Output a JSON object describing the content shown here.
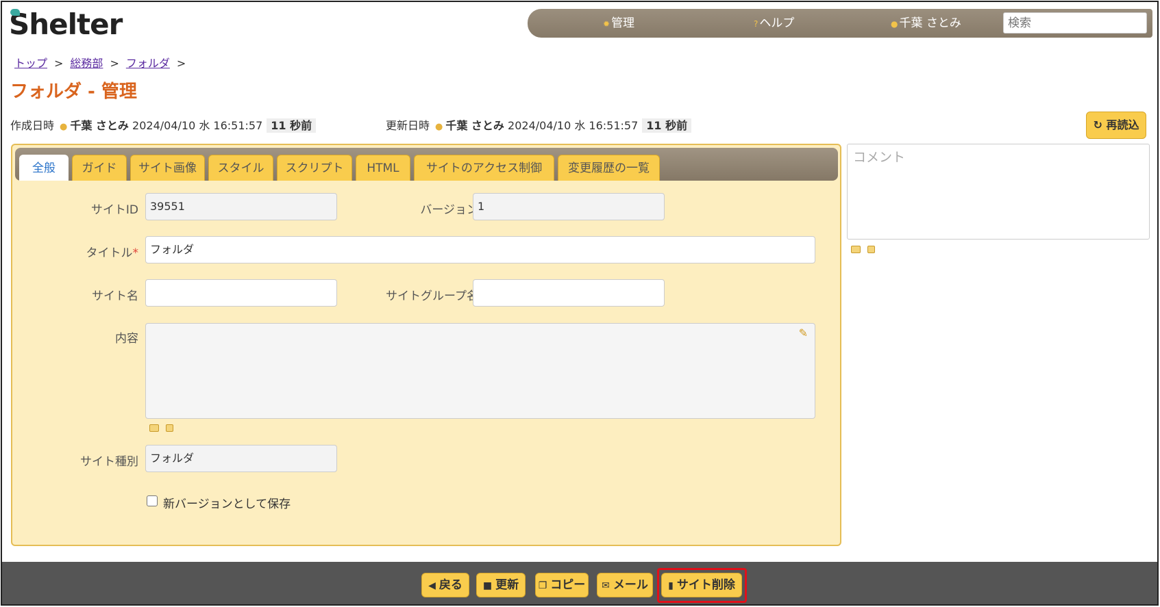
{
  "app": {
    "logo": "Shelter"
  },
  "topnav": {
    "manage": "管理",
    "help": "ヘルプ",
    "user": "千葉 さとみ",
    "search_placeholder": "検索"
  },
  "breadcrumb": [
    "トップ",
    "総務部",
    "フォルダ"
  ],
  "breadcrumb_sep": ">",
  "page_title": "フォルダ - 管理",
  "meta": {
    "created_label": "作成日時",
    "created_user": "千葉 さとみ",
    "created_time": "2024/04/10 水 16:51:57",
    "created_ago": "11 秒前",
    "updated_label": "更新日時",
    "updated_user": "千葉 さとみ",
    "updated_time": "2024/04/10 水 16:51:57",
    "updated_ago": "11 秒前"
  },
  "reload_label": "再読込",
  "tabs": [
    "全般",
    "ガイド",
    "サイト画像",
    "スタイル",
    "スクリプト",
    "HTML",
    "サイトのアクセス制御",
    "変更履歴の一覧"
  ],
  "form": {
    "site_id_label": "サイトID",
    "site_id_value": "39551",
    "version_label": "バージョン",
    "version_value": "1",
    "title_label": "タイトル",
    "title_required": "*",
    "title_value": "フォルダ",
    "site_name_label": "サイト名",
    "site_name_value": "",
    "site_group_label": "サイトグループ名",
    "site_group_value": "",
    "content_label": "内容",
    "site_type_label": "サイト種別",
    "site_type_value": "フォルダ",
    "save_new_version_label": "新バージョンとして保存"
  },
  "comment_placeholder": "コメント",
  "footer": {
    "back": "戻る",
    "update": "更新",
    "copy": "コピー",
    "mail": "メール",
    "delete_site": "サイト削除"
  },
  "colors": {
    "accent": "#f9cc4d",
    "title": "#d9641e",
    "panel": "#fdeec0",
    "highlight": "#e0101a"
  }
}
